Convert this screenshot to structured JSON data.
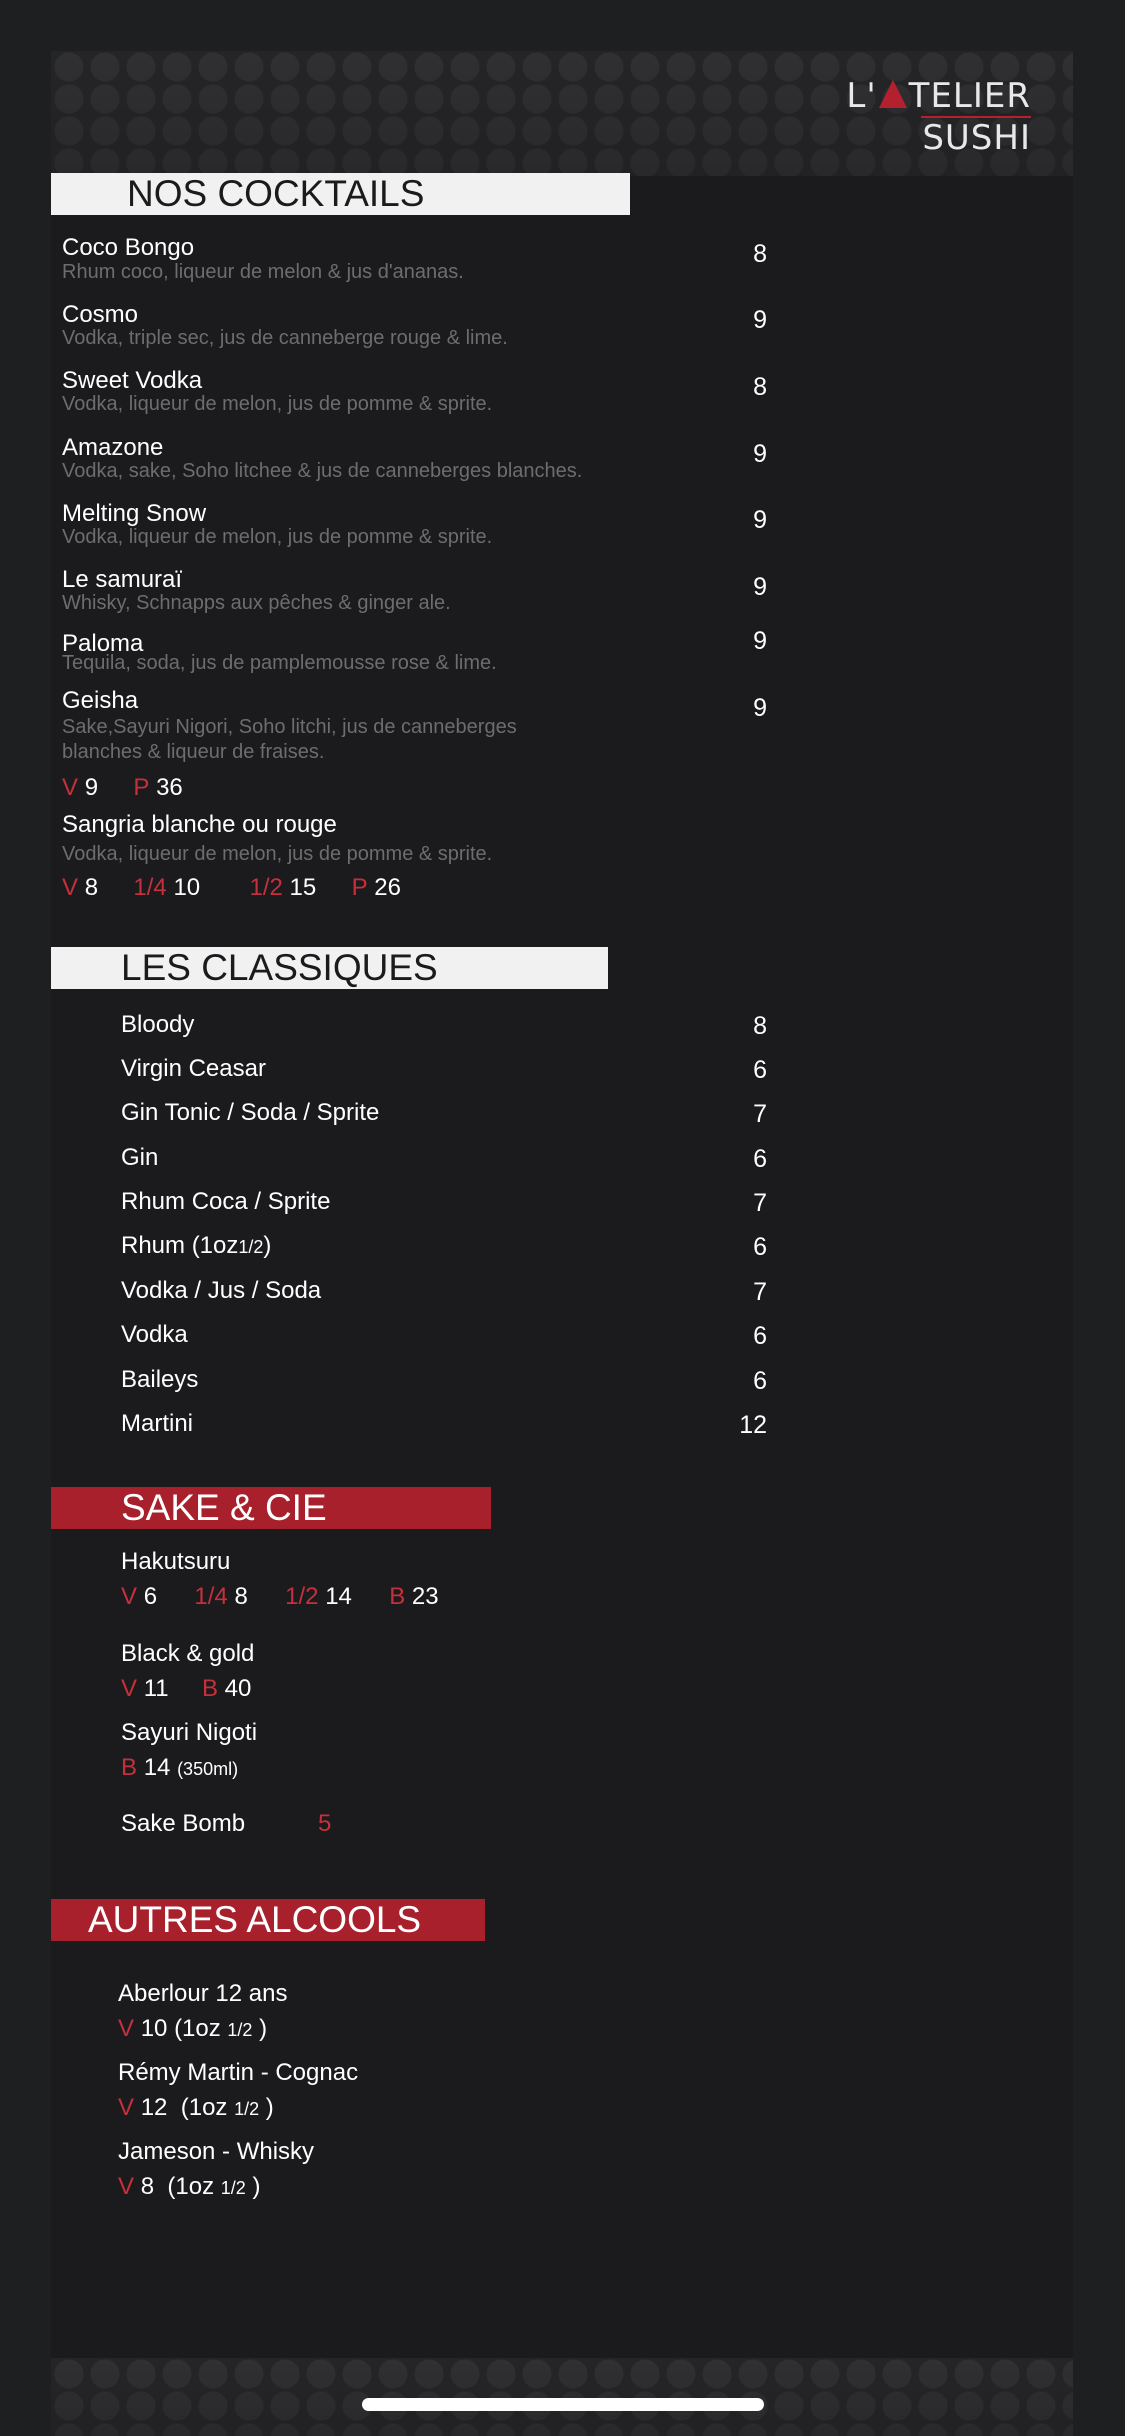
{
  "brand": {
    "line1_left": "L'",
    "line1_right": "TELIER",
    "line2": "SUSHI"
  },
  "cocktails": {
    "title": "NOS COCKTAILS",
    "items": [
      {
        "name": "Coco Bongo",
        "desc": "Rhum coco, liqueur de melon & jus d'ananas.",
        "price": "8"
      },
      {
        "name": "Cosmo",
        "desc": "Vodka, triple sec, jus de canneberge rouge & lime.",
        "price": "9"
      },
      {
        "name": "Sweet Vodka",
        "desc": "Vodka, liqueur de melon, jus de pomme & sprite.",
        "price": "8"
      },
      {
        "name": "Amazone",
        "desc": "Vodka, sake, Soho litchee & jus de canneberges blanches.",
        "price": "9"
      },
      {
        "name": "Melting Snow",
        "desc": "Vodka, liqueur de melon, jus de pomme & sprite.",
        "price": "9"
      },
      {
        "name": "Le samuraï",
        "desc": "Whisky, Schnapps aux pêches & ginger ale.",
        "price": "9"
      },
      {
        "name": "Paloma",
        "desc": "Tequila, soda, jus de pamplemousse rose & lime.",
        "price": "9"
      },
      {
        "name": "Geisha",
        "desc": "Sake,Sayuri Nigori, Soho litchi, jus de canneberges",
        "desc2": "blanches & liqueur de fraises.",
        "price": "9"
      }
    ],
    "geisha_sizes": [
      {
        "label": "V",
        "value": "9"
      },
      {
        "label": "P",
        "value": "36"
      }
    ],
    "sangria": {
      "name": "Sangria blanche ou rouge",
      "desc": "Vodka, liqueur de melon, jus de pomme & sprite.",
      "sizes": [
        {
          "label": "V",
          "value": "8"
        },
        {
          "label": "1/4",
          "value": "10"
        },
        {
          "label": "1/2",
          "value": "15"
        },
        {
          "label": "P",
          "value": "26"
        }
      ]
    }
  },
  "classiques": {
    "title": "LES CLASSIQUES",
    "items": [
      {
        "name": "Bloody",
        "price": "8"
      },
      {
        "name": "Virgin Ceasar",
        "price": "6"
      },
      {
        "name": "Gin Tonic / Soda / Sprite",
        "price": "7"
      },
      {
        "name": "Gin",
        "price": "6"
      },
      {
        "name": "Rhum Coca / Sprite",
        "price": "7"
      },
      {
        "name": "Rhum (1oz",
        "name_small": "1/2",
        "name_end": ")",
        "price": "6"
      },
      {
        "name": "Vodka / Jus / Soda",
        "price": "7"
      },
      {
        "name": "Vodka",
        "price": "6"
      },
      {
        "name": "Baileys",
        "price": "6"
      },
      {
        "name": "Martini",
        "price": "12"
      }
    ]
  },
  "sake": {
    "title": "SAKE & CIE",
    "hakutsuru": {
      "name": "Hakutsuru",
      "sizes": [
        {
          "label": "V",
          "value": "6"
        },
        {
          "label": "1/4",
          "value": "8"
        },
        {
          "label": "1/2",
          "value": "14"
        },
        {
          "label": "B",
          "value": "23"
        }
      ]
    },
    "black_gold": {
      "name": "Black & gold",
      "sizes": [
        {
          "label": "V",
          "value": "11"
        },
        {
          "label": "B",
          "value": "40"
        }
      ]
    },
    "sayuri": {
      "name": "Sayuri Nigoti",
      "label": "B",
      "value": "14",
      "note": "(350ml)"
    },
    "bomb": {
      "name": "Sake Bomb",
      "price": "5"
    }
  },
  "autres": {
    "title": "AUTRES ALCOOLS",
    "items": [
      {
        "name": "Aberlour 12 ans",
        "label": "V",
        "value": "10",
        "oz": "(1oz",
        "frac": "1/2",
        "close": ")"
      },
      {
        "name": "Rémy Martin - Cognac",
        "label": "V",
        "value": "12",
        "oz": "(1oz",
        "frac": "1/2",
        "close": ")"
      },
      {
        "name": "Jameson - Whisky",
        "label": "V",
        "value": "8",
        "oz": "(1oz",
        "frac": "1/2",
        "close": ")"
      }
    ]
  },
  "colors": {
    "accent_red": "#a9202d",
    "background": "#1b1b1d",
    "muted_text": "#6d6d70"
  }
}
